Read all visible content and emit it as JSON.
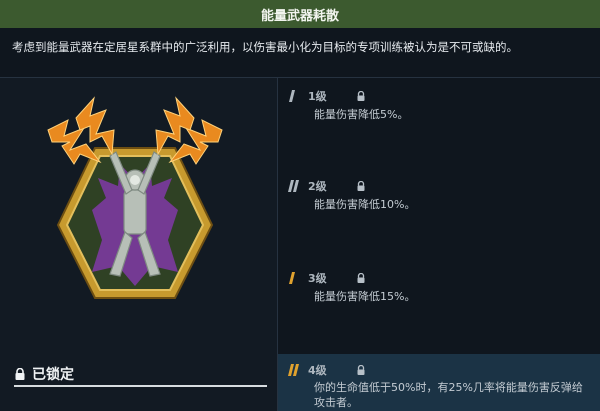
{
  "header": {
    "title": "能量武器耗散"
  },
  "description": "考虑到能量武器在定居星系群中的广泛利用，以伤害最小化为目标的专项训练被认为是不可或缺的。",
  "status": {
    "locked_label": "已锁定"
  },
  "tiers": [
    {
      "level": "1级",
      "effect": "能量伤害降低5%。"
    },
    {
      "level": "2级",
      "effect": "能量伤害降低10%。"
    },
    {
      "level": "3级",
      "effect": "能量伤害降低15%。"
    },
    {
      "level": "4级",
      "effect": "你的生命值低于50%时，有25%几率将能量伤害反弹给攻击者。"
    }
  ],
  "colors": {
    "title_bar": "#3c5a2f",
    "active_tier": "#1b3345",
    "badge_gold": "#c79a2e",
    "badge_green": "#2f4124",
    "lightning": "#e98a1f",
    "aura_purple": "#7c3aa0"
  }
}
